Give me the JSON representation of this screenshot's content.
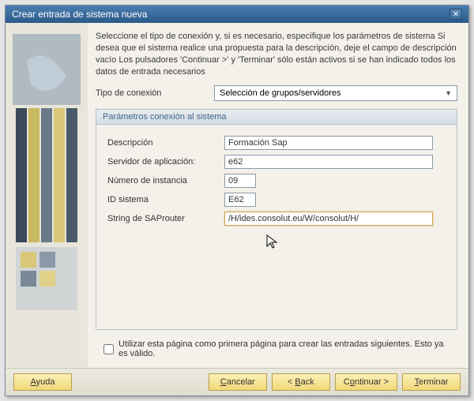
{
  "window": {
    "title": "Crear entrada de sistema nueva"
  },
  "intro": "Seleccione el tipo de conexión y, si es necesario, especifique los parámetros de sistema Si desea que el sistema realice una propuesta para la descripción, deje el campo de descripción vacío Los pulsadores 'Continuar >' y 'Terminar' sólo están activos si se han indicado todos los datos de entrada necesarios",
  "connType": {
    "label": "Tipo de conexión",
    "value": "Selección de grupos/servidores"
  },
  "group": {
    "title": "Parámetros conexión al sistema"
  },
  "fields": {
    "desc": {
      "label": "Descripción",
      "value": "Formación Sap"
    },
    "server": {
      "label": "Servidor de aplicación:",
      "value": "e62"
    },
    "inst": {
      "label": "Número de instancia",
      "value": "09"
    },
    "sysid": {
      "label": "ID sistema",
      "value": "E62"
    },
    "router": {
      "label": "String de SAProuter",
      "value": "/H/ides.consolut.eu/W/consolut/H/"
    }
  },
  "checkbox": {
    "label": "Utilizar esta página como primera página para crear las entradas siguientes. Esto ya es válido."
  },
  "buttons": {
    "help": "Ayuda",
    "cancel": "Cancelar",
    "back": "< Back",
    "next": "Continuar >",
    "finish": "Terminar"
  }
}
